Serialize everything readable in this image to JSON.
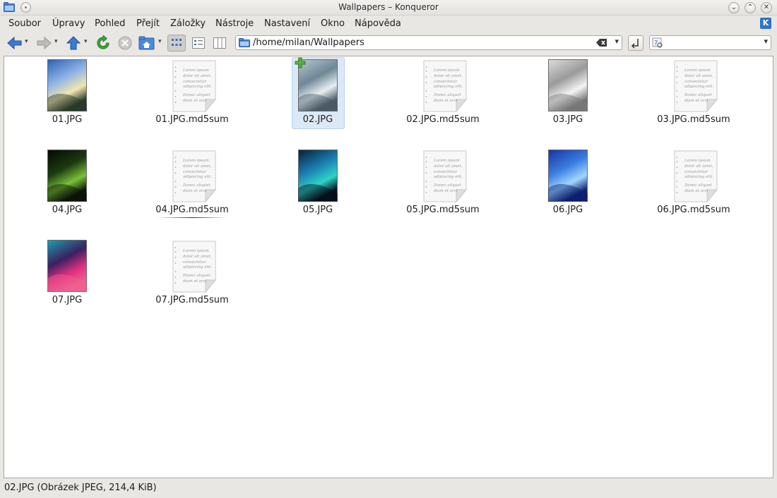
{
  "window": {
    "title": "Wallpapers – Konqueror"
  },
  "menu": {
    "items": [
      {
        "label": "Soubor"
      },
      {
        "label": "Úpravy"
      },
      {
        "label": "Pohled"
      },
      {
        "label": "Přejít"
      },
      {
        "label": "Záložky"
      },
      {
        "label": "Nástroje"
      },
      {
        "label": "Nastavení"
      },
      {
        "label": "Okno"
      },
      {
        "label": "Nápověda"
      }
    ]
  },
  "toolbar": {
    "icons": [
      "back-icon",
      "forward-icon",
      "up-icon",
      "reload-icon",
      "stop-icon",
      "home-icon",
      "icon-view-icon",
      "details-view-icon",
      "columns-view-icon"
    ],
    "location": "/home/milan/Wallpapers",
    "search_value": ""
  },
  "files": [
    {
      "name": "01.JPG",
      "kind": "image",
      "colors": [
        "#2d5fb4",
        "#8fb4e6",
        "#f2e6b0",
        "#2a3a2a"
      ]
    },
    {
      "name": "01.JPG.md5sum",
      "kind": "text"
    },
    {
      "name": "02.JPG",
      "kind": "image",
      "colors": [
        "#b8c8d4",
        "#6f8796",
        "#e8eef2",
        "#4a5a66"
      ]
    },
    {
      "name": "02.JPG.md5sum",
      "kind": "text"
    },
    {
      "name": "03.JPG",
      "kind": "image",
      "colors": [
        "#dcdcdc",
        "#9a9a9a",
        "#f4f4f4",
        "#777777"
      ]
    },
    {
      "name": "03.JPG.md5sum",
      "kind": "text"
    },
    {
      "name": "04.JPG",
      "kind": "image",
      "colors": [
        "#050805",
        "#1c3a10",
        "#79c13a",
        "#0a1406"
      ]
    },
    {
      "name": "04.JPG.md5sum",
      "kind": "text"
    },
    {
      "name": "05.JPG",
      "kind": "image",
      "colors": [
        "#062036",
        "#1a7fb3",
        "#2ed2c6",
        "#04101c"
      ]
    },
    {
      "name": "05.JPG.md5sum",
      "kind": "text"
    },
    {
      "name": "06.JPG",
      "kind": "image",
      "colors": [
        "#1433a6",
        "#3b7fe0",
        "#9fd8ff",
        "#0d1f6e"
      ]
    },
    {
      "name": "06.JPG.md5sum",
      "kind": "text"
    },
    {
      "name": "07.JPG",
      "kind": "image",
      "colors": [
        "#1d9fb0",
        "#3a2060",
        "#e0307e",
        "#f06090"
      ]
    },
    {
      "name": "07.JPG.md5sum",
      "kind": "text"
    }
  ],
  "doc_text": [
    "Lorem ipsum",
    "dolor sit amet,",
    "consectetur",
    "adipiscing elit.",
    "Donec aliquet",
    "diam et orci"
  ],
  "selected": "02.JPG",
  "hovered": "04.JPG.md5sum",
  "status": {
    "text": "02.JPG (Obrázek JPEG, 214,4 KiB)"
  },
  "colors": {
    "accent": "#2f72c9",
    "selection": "#dbe9f7",
    "reload": "#3aa13a",
    "arrows": "#2f6fc4"
  }
}
